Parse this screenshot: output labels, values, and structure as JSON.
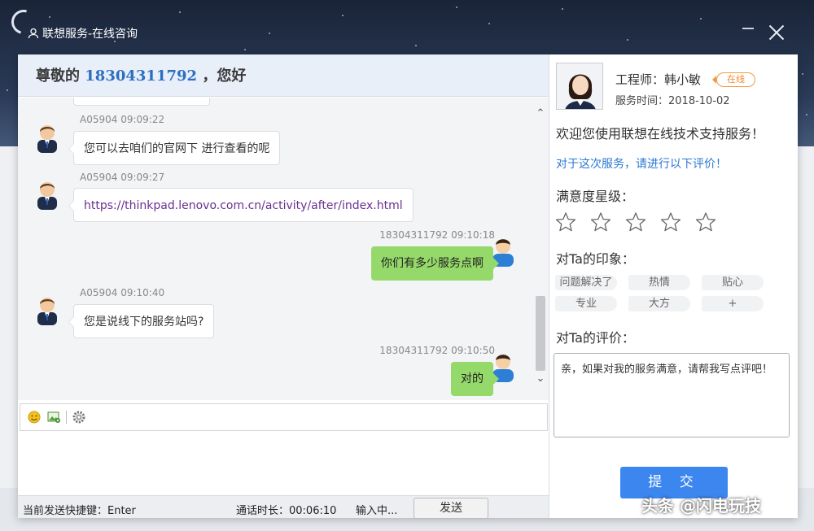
{
  "window": {
    "title": "联想服务-在线咨询"
  },
  "greeting": {
    "prefix": "尊敬的",
    "phone": "18304311792",
    "suffix": "，您好"
  },
  "messages": [
    {
      "side": "in",
      "sender": "A05904",
      "time": "09:09:22",
      "meta": "A05904 09:09:22",
      "text": "您可以去咱们的官网下 进行查看的呢"
    },
    {
      "side": "in",
      "sender": "A05904",
      "time": "09:09:27",
      "meta": "A05904 09:09:27",
      "text": "https://thinkpad.lenovo.com.cn/activity/after/index.html"
    },
    {
      "side": "out",
      "sender": "18304311792",
      "time": "09:10:18",
      "meta": "18304311792 09:10:18",
      "text": "你们有多少服务点啊"
    },
    {
      "side": "in",
      "sender": "A05904",
      "time": "09:10:40",
      "meta": "A05904 09:10:40",
      "text": "您是说线下的服务站吗?"
    },
    {
      "side": "out",
      "sender": "18304311792",
      "time": "09:10:50",
      "meta": "18304311792 09:10:50",
      "text": "对的"
    }
  ],
  "statusbar": {
    "shortcut": "当前发送快捷键：Enter",
    "duration": "通话时长：00:06:10",
    "typing": "输入中...",
    "send_label": "发送"
  },
  "engineer": {
    "name": "工程师：韩小敏",
    "status": "在线",
    "service_time": "服务时间：2018-10-02"
  },
  "rating": {
    "welcome": "欢迎您使用联想在线技术支持服务！",
    "prompt": "对于这次服务，请进行以下评价！",
    "stars_label": "满意度星级：",
    "stars_value": 0,
    "stars_max": 5,
    "impression_label": "对Ta的印象：",
    "tags": [
      "问题解决了",
      "热情",
      "贴心",
      "专业",
      "大方",
      "+"
    ],
    "comment_label": "对Ta的评价：",
    "comment_text": "亲，如果对我的服务满意，请帮我写点评吧！",
    "submit_label": "提 交"
  },
  "watermark": "头条 @闪电玩技",
  "colors": {
    "accent_blue": "#3c86f0",
    "link_blue": "#2c78d4",
    "outgoing_bubble": "#95d96a",
    "online_orange": "#f08a30"
  }
}
